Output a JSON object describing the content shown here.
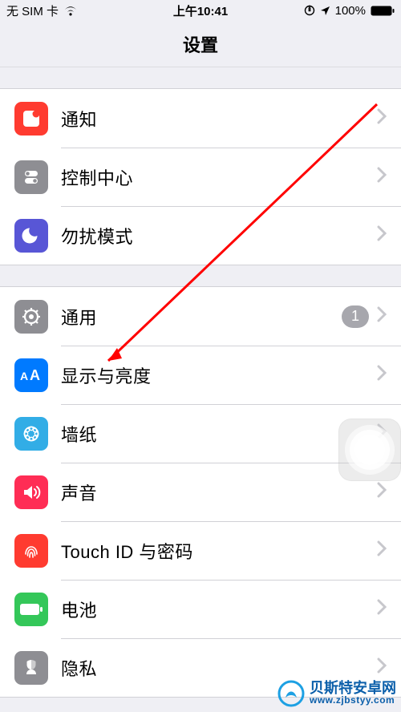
{
  "status_bar": {
    "carrier": "无 SIM 卡",
    "time": "上午10:41",
    "battery_percent": "100%"
  },
  "nav": {
    "title": "设置"
  },
  "groups": [
    {
      "rows": [
        {
          "key": "notifications",
          "label": "通知",
          "icon_name": "notifications-icon",
          "icon_bg": "#ff3b30",
          "chevron": true
        },
        {
          "key": "control",
          "label": "控制中心",
          "icon_name": "control-center-icon",
          "icon_bg": "#8e8e93",
          "chevron": true
        },
        {
          "key": "dnd",
          "label": "勿扰模式",
          "icon_name": "do-not-disturb-icon",
          "icon_bg": "#5856d6",
          "chevron": true
        }
      ]
    },
    {
      "rows": [
        {
          "key": "general",
          "label": "通用",
          "icon_name": "general-icon",
          "icon_bg": "#8e8e93",
          "chevron": true,
          "badge": "1"
        },
        {
          "key": "display",
          "label": "显示与亮度",
          "icon_name": "display-icon",
          "icon_bg": "#007aff",
          "chevron": true
        },
        {
          "key": "wallpaper",
          "label": "墙纸",
          "icon_name": "wallpaper-icon",
          "icon_bg": "#32ade6",
          "chevron": true
        },
        {
          "key": "sound",
          "label": "声音",
          "icon_name": "sound-icon",
          "icon_bg": "#ff3b30",
          "chevron": true
        },
        {
          "key": "touchid",
          "label": "Touch ID 与密码",
          "icon_name": "touch-id-icon",
          "icon_bg": "#ff3b30",
          "chevron": true
        },
        {
          "key": "battery",
          "label": "电池",
          "icon_name": "battery-icon",
          "icon_bg": "#34c759",
          "chevron": true
        },
        {
          "key": "privacy",
          "label": "隐私",
          "icon_name": "privacy-icon",
          "icon_bg": "#8e8e93",
          "chevron": true
        }
      ]
    }
  ],
  "annotation": {
    "target_row_key": "display"
  },
  "watermark": {
    "main": "贝斯特安卓网",
    "sub": "www.zjbstyy.com"
  }
}
